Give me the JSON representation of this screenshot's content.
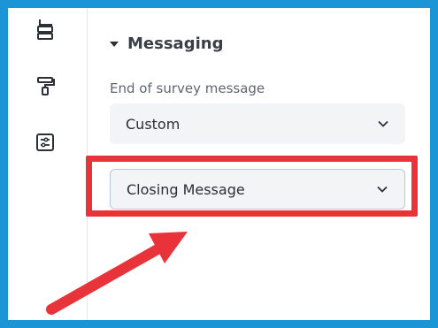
{
  "sidebar": {
    "icons": [
      "flow-icon",
      "paint-roller-icon",
      "settings-sliders-icon"
    ]
  },
  "messaging": {
    "section_title": "Messaging",
    "end_label": "End of survey message",
    "end_value": "Custom",
    "closing_value": "Closing Message"
  },
  "colors": {
    "frame": "#1b95d6",
    "highlight": "#e8333b",
    "arrow": "#e8333b"
  }
}
